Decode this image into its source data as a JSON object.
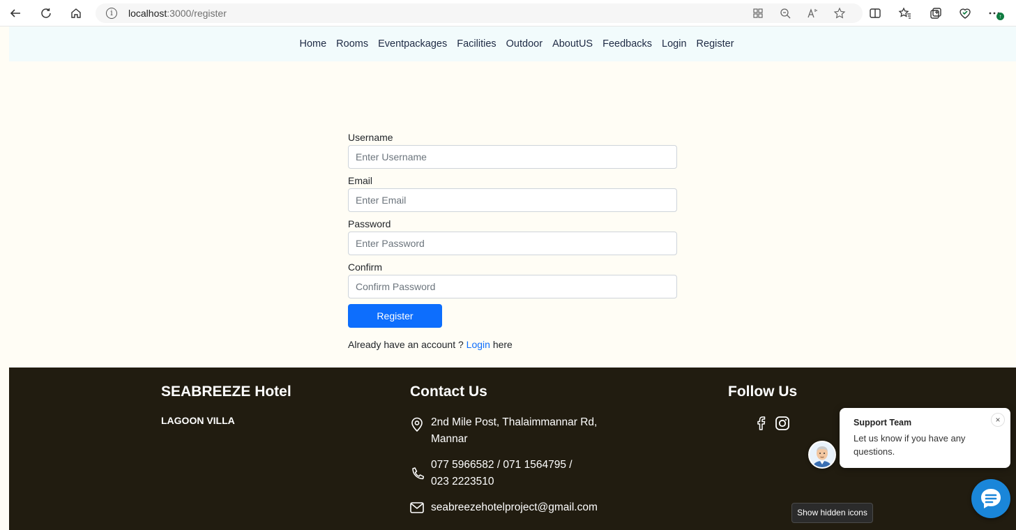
{
  "browser": {
    "url_host": "localhost",
    "url_path": ":3000/register",
    "info_icon": "info-icon"
  },
  "nav": {
    "items": [
      "Home",
      "Rooms",
      "Eventpackages",
      "Facilities",
      "Outdoor",
      "AboutUS",
      "Feedbacks",
      "Login",
      "Register"
    ]
  },
  "form": {
    "username_label": "Username",
    "username_placeholder": "Enter Username",
    "email_label": "Email",
    "email_placeholder": "Enter Email",
    "password_label": "Password",
    "password_placeholder": "Enter Password",
    "confirm_label": "Confirm",
    "confirm_placeholder": "Confirm Password",
    "submit_label": "Register",
    "login_prefix": "Already have an account ? ",
    "login_link": "Login",
    "login_suffix": " here"
  },
  "footer": {
    "hotel_title": "SEABREEZE Hotel",
    "hotel_subtitle": "LAGOON VILLA",
    "contact_title": "Contact Us",
    "address_line1": "2nd Mile Post, Thalaimmannar Rd,",
    "address_line2": "Mannar",
    "phone_line1": "077 5966582 / 071 1564795 /",
    "phone_line2": "023 2223510",
    "email": "seabreezehotelproject@gmail.com",
    "follow_title": "Follow Us"
  },
  "chat": {
    "title": "Support Team",
    "message": "Let us know if you have any questions.",
    "close_symbol": "×"
  },
  "tooltip": {
    "text": "Show hidden icons"
  },
  "colors": {
    "primary": "#0d6efd",
    "footer_bg": "#211c10",
    "nav_bg": "#f2fbfc",
    "page_bg": "#fffdf5",
    "chat_blue": "#1a86d9"
  }
}
